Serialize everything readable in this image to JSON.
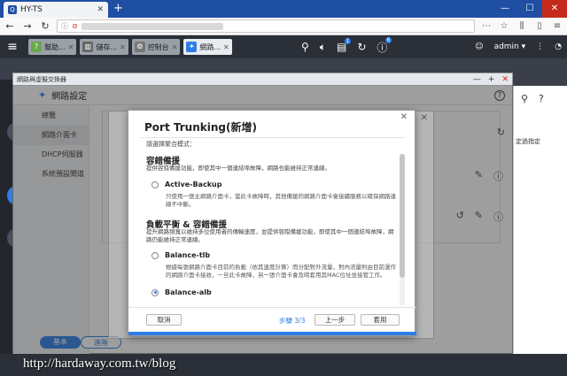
{
  "browser": {
    "tab_title": "HY-TS",
    "tab_favicon": "Q",
    "newtab": "+",
    "win_min": "—",
    "win_max": "☐",
    "win_close": "✕"
  },
  "qts": {
    "user": "admin ▾",
    "app_tabs": [
      {
        "label": "幫助...",
        "icon": "?",
        "color": "#6aa84f"
      },
      {
        "label": "儲存...",
        "icon": "▥",
        "color": "#666666"
      },
      {
        "label": "控制台",
        "icon": "⚙",
        "color": "#777777"
      },
      {
        "label": "網路...",
        "icon": "✦",
        "color": "#2d7ee6"
      }
    ],
    "badge_a": "1",
    "badge_b": "6"
  },
  "app": {
    "window_title": "網路與虛擬交換器",
    "header_title": "網路設定",
    "sidebar": [
      {
        "label": "總覽"
      },
      {
        "label": "網路介面卡"
      },
      {
        "label": "DHCP伺服器"
      },
      {
        "label": "系統預設閘道"
      }
    ],
    "mode_basic": "基本",
    "mode_advanced": "進階",
    "right_text": "定過指定"
  },
  "dialog": {
    "title": "Port Trunking(新增)",
    "select_mode_label": "請選擇聚合模式：",
    "section1_title": "容錯備援",
    "section1_desc": "提供容錯備援功能，即使其中一個連結埠故障，網路也能維持正常連線。",
    "opt1_label": "Active-Backup",
    "opt1_desc": "只使用一張主網路介面卡，當此卡故障時，其他備援的網路介面卡會接續服務以確保網路連線不中斷。",
    "section2_title": "負載平衡 & 容錯備援",
    "section2_desc": "提升網路頻寬以維持多位使用者的傳輸速度，並提供容錯備援功能，即使其中一個連結埠故障，網路仍能維持正常連線。",
    "opt2_label": "Balance-tlb",
    "opt2_desc": "根據每張網路介面卡目前的負載（依其速度計算）而分配對外流量，對內流量則由目前運作的網路介面卡接收，一旦此卡故障，另一張介面卡會及時套用其MAC位址並接管工作。",
    "opt3_label": "Balance-alb",
    "cancel": "取消",
    "step": "步驟 3/3",
    "prev": "上一步",
    "apply": "套用"
  },
  "watermark": "http://hardaway.com.tw/blog"
}
